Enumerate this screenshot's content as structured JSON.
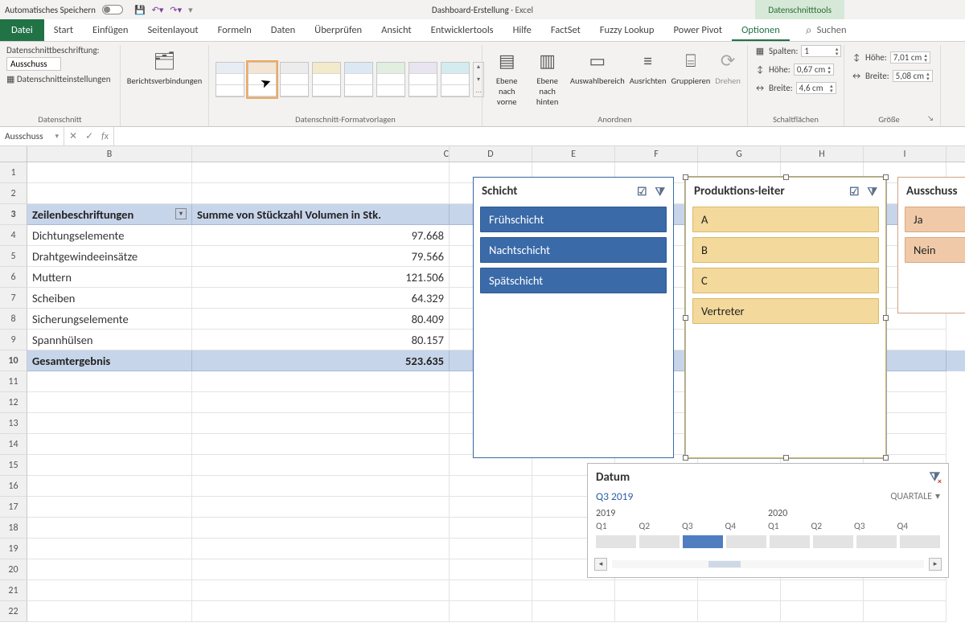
{
  "titlebar": {
    "autosave": "Automatisches Speichern",
    "document": "Dashboard-Erstellung",
    "app": "Excel",
    "contextual": "Datenschnitttools"
  },
  "tabs": {
    "file": "Datei",
    "items": [
      "Start",
      "Einfügen",
      "Seitenlayout",
      "Formeln",
      "Daten",
      "Überprüfen",
      "Ansicht",
      "Entwicklertools",
      "Hilfe",
      "FactSet",
      "Fuzzy Lookup",
      "Power Pivot"
    ],
    "active": "Optionen",
    "search": "Suchen"
  },
  "ribbon": {
    "g1": {
      "caption_label": "Datenschnittbeschriftung:",
      "caption_value": "Ausschuss",
      "settings": "Datenschnitteinstellungen",
      "label": "Datenschnitt"
    },
    "g2": {
      "btn": "Berichtsverbindungen"
    },
    "g3": {
      "label": "Datenschnitt-Formatvorlagen"
    },
    "g4": {
      "bring": "Ebene nach\nvorne",
      "send": "Ebene nach\nhinten",
      "selpane": "Auswahlbereich",
      "align": "Ausrichten",
      "group": "Gruppieren",
      "rotate": "Drehen",
      "label": "Anordnen"
    },
    "g5": {
      "cols_label": "Spalten:",
      "cols": "1",
      "height_label": "Höhe:",
      "height": "0,67 cm",
      "width_label": "Breite:",
      "width": "4,6 cm",
      "label": "Schaltflächen"
    },
    "g6": {
      "height_label": "Höhe:",
      "height": "7,01 cm",
      "width_label": "Breite:",
      "width": "5,08 cm",
      "label": "Größe"
    }
  },
  "namebox": "Ausschuss",
  "columns": [
    "B",
    "C",
    "D",
    "E",
    "F",
    "G",
    "H",
    "I"
  ],
  "pivot": {
    "header_row": "Zeilenbeschriftungen",
    "header_val": "Summe von Stückzahl Volumen in Stk.",
    "rows": [
      {
        "label": "Dichtungselemente",
        "value": "97.668"
      },
      {
        "label": "Drahtgewindeeinsätze",
        "value": "79.566"
      },
      {
        "label": "Muttern",
        "value": "121.506"
      },
      {
        "label": "Scheiben",
        "value": "64.329"
      },
      {
        "label": "Sicherungselemente",
        "value": "80.409"
      },
      {
        "label": "Spannhülsen",
        "value": "80.157"
      }
    ],
    "total_label": "Gesamtergebnis",
    "total_value": "523.635"
  },
  "slicers": {
    "schicht": {
      "title": "Schicht",
      "items": [
        "Frühschicht",
        "Nachtschicht",
        "Spätschicht"
      ]
    },
    "prod": {
      "title": "Produktions-leiter",
      "items": [
        "A",
        "B",
        "C",
        "Vertreter"
      ]
    },
    "ausschuss": {
      "title": "Ausschuss",
      "items": [
        "Ja",
        "Nein"
      ]
    }
  },
  "timeline": {
    "title": "Datum",
    "selection": "Q3 2019",
    "granularity": "QUARTALE",
    "years": [
      "2019",
      "2020"
    ],
    "quarters": [
      "Q1",
      "Q2",
      "Q3",
      "Q4",
      "Q1",
      "Q2",
      "Q3",
      "Q4"
    ],
    "active_index": 2
  }
}
